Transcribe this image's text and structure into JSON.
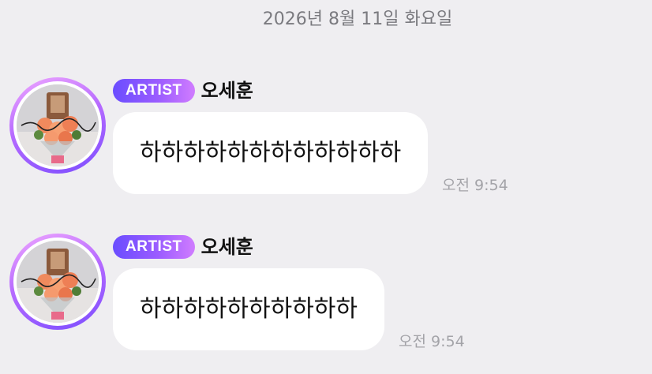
{
  "date_header": "2026년 8월 11일 화요일",
  "messages": [
    {
      "badge": "ARTIST",
      "sender": "오세훈",
      "text": "하하하하하하하하하하하하",
      "time": "오전 9:54"
    },
    {
      "badge": "ARTIST",
      "sender": "오세훈",
      "text": "하하하하하하하하하하",
      "time": "오전 9:54"
    }
  ],
  "colors": {
    "background": "#efeef1",
    "badge_gradient_start": "#6a4dff",
    "badge_gradient_end": "#d07cff",
    "bubble": "#ffffff"
  },
  "icons": {
    "avatar": "flower-bouquet-profile-photo"
  }
}
